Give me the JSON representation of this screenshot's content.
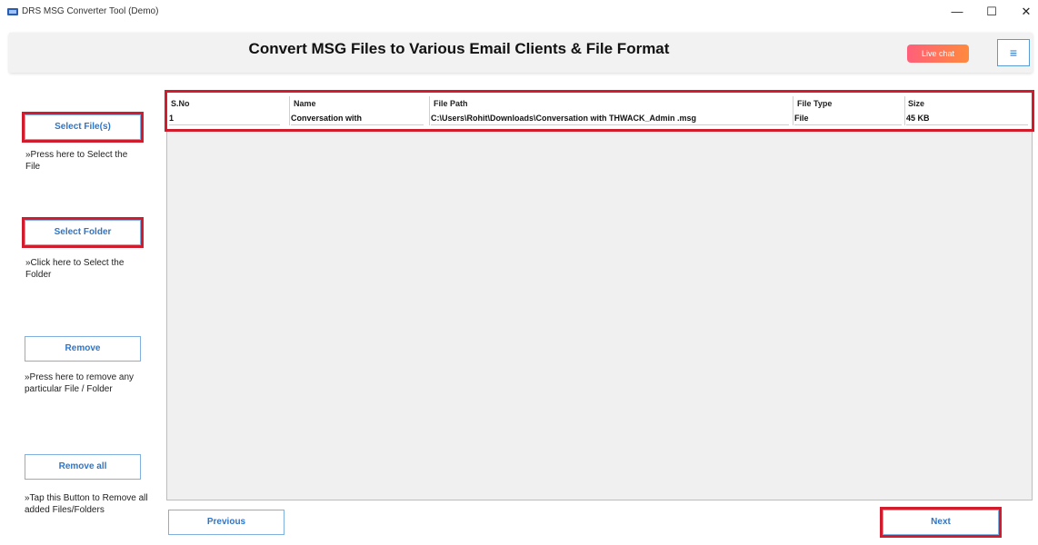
{
  "window": {
    "title": "DRS MSG Converter Tool (Demo)",
    "minimize": "—",
    "maximize": "☐",
    "close": "✕"
  },
  "header": {
    "title": "Convert MSG Files to Various Email Clients & File Format",
    "live_chat": "Live chat",
    "menu_icon": "≡"
  },
  "sidebar": {
    "select_files": {
      "label": "Select File(s)",
      "help": "»Press here to Select the File"
    },
    "select_folder": {
      "label": "Select Folder",
      "help": "»Click here to Select the Folder"
    },
    "remove": {
      "label": "Remove",
      "help": "»Press here to remove any particular File / Folder"
    },
    "remove_all": {
      "label": "Remove all",
      "help": "»Tap this Button to Remove all added Files/Folders"
    }
  },
  "table": {
    "columns": [
      "S.No",
      "Name",
      "File Path",
      "File Type",
      "Size"
    ],
    "rows": [
      [
        "1",
        "Conversation with",
        "C:\\Users\\Rohit\\Downloads\\Conversation with THWACK_Admin .msg",
        "File",
        "45 KB"
      ]
    ]
  },
  "footer": {
    "previous": "Previous",
    "next": "Next"
  },
  "colors": {
    "highlight": "#d01c2c",
    "button_text": "#2f75c7",
    "button_border": "#7fb0e0"
  }
}
